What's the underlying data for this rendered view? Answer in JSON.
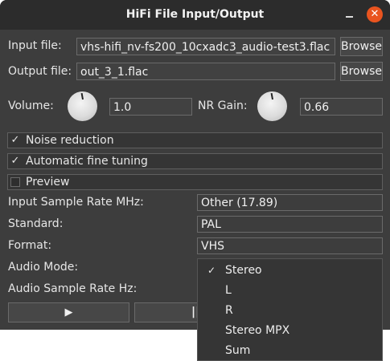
{
  "window": {
    "title": "HiFi File Input/Output",
    "minimize_icon": "minimize-icon",
    "close_icon": "close-icon",
    "close_glyph": "✕",
    "close_color": "#e9541f"
  },
  "input_file": {
    "label": "Input file:",
    "value": "vhs-hifi_nv-fs200_10cxadc3_audio-test3.flac",
    "button": "Browse"
  },
  "output_file": {
    "label": "Output file:",
    "value": "out_3_1.flac",
    "button": "Browse"
  },
  "volume": {
    "label": "Volume:",
    "value": "1.0"
  },
  "nr_gain": {
    "label": "NR Gain:",
    "value": "0.66"
  },
  "checkboxes": [
    {
      "label": "Noise reduction",
      "checked": true,
      "glyph": "✓"
    },
    {
      "label": "Automatic fine tuning",
      "checked": true,
      "glyph": "✓"
    },
    {
      "label": "Preview",
      "checked": false,
      "glyph": ""
    }
  ],
  "settings": {
    "input_sample_rate": {
      "label": "Input Sample Rate MHz:",
      "value": "Other (17.89)"
    },
    "standard": {
      "label": "Standard:",
      "value": "PAL"
    },
    "format": {
      "label": "Format:",
      "value": "VHS"
    },
    "audio_mode": {
      "label": "Audio Mode:"
    },
    "audio_sample_rate": {
      "label": "Audio Sample Rate Hz:"
    }
  },
  "audio_mode_dropdown": {
    "selected": "Stereo",
    "check_glyph": "✓",
    "options": [
      "Stereo",
      "L",
      "R",
      "Stereo MPX",
      "Sum"
    ]
  },
  "controls": {
    "play_glyph": "▶",
    "pause_glyph": "||"
  }
}
